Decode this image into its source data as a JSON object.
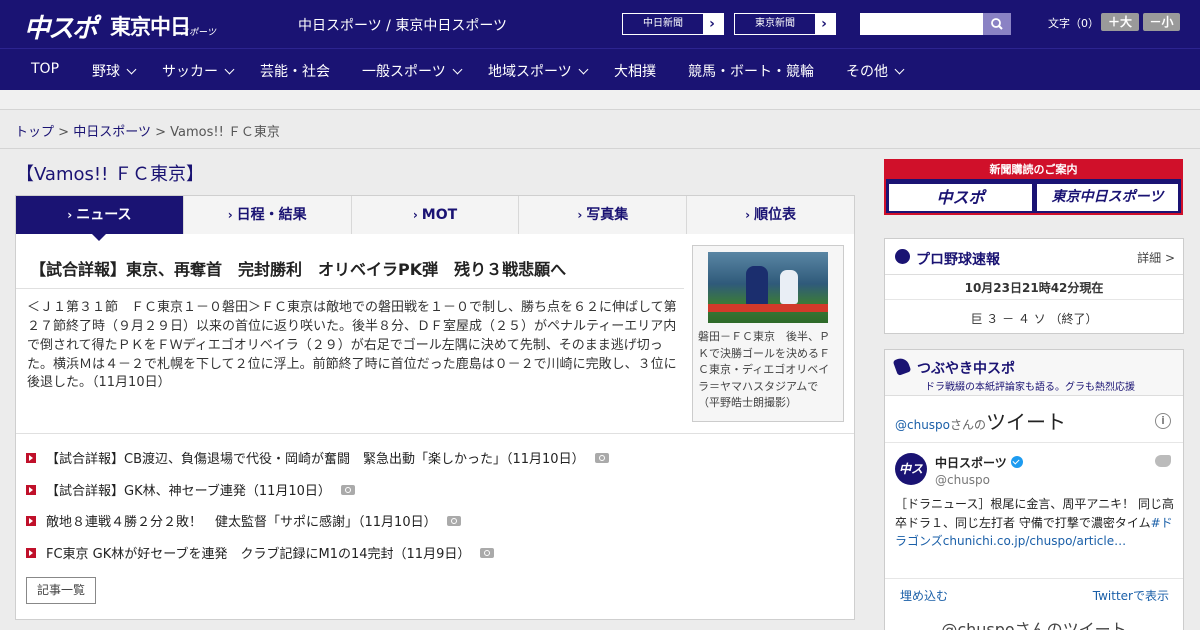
{
  "header": {
    "logo_chuspo": "中スポ",
    "logo_tokyo": "東京中日",
    "logo_tokyo_sub": "スポーツ",
    "site_title": "中日スポーツ / 東京中日スポーツ",
    "paper_buttons": [
      "中日新聞",
      "東京新聞"
    ],
    "search_placeholder": "",
    "text_size_label": "文字（0）",
    "size_up": "＋大",
    "size_down": "－小"
  },
  "nav": {
    "items": [
      {
        "label": "TOP",
        "has_menu": false
      },
      {
        "label": "野球",
        "has_menu": true
      },
      {
        "label": "サッカー",
        "has_menu": true
      },
      {
        "label": "芸能・社会",
        "has_menu": false
      },
      {
        "label": "一般スポーツ",
        "has_menu": true
      },
      {
        "label": "地域スポーツ",
        "has_menu": true
      },
      {
        "label": "大相撲",
        "has_menu": false
      },
      {
        "label": "競馬・ボート・競輪",
        "has_menu": false
      },
      {
        "label": "その他",
        "has_menu": true
      }
    ]
  },
  "breadcrumb": {
    "home": "トップ",
    "section": "中日スポーツ",
    "current": "Vamos!! ＦＣ東京",
    "sep": ">"
  },
  "section_title": "【Vamos!! ＦＣ東京】",
  "tabs": [
    "ニュース",
    "日程・結果",
    "MOT",
    "写真集",
    "順位表"
  ],
  "article": {
    "headline": "【試合詳報】東京、再奪首　完封勝利　オリベイラPK弾　残り３戦悲願へ",
    "body": "＜Ｊ１第３１節　ＦＣ東京１－０磐田＞ＦＣ東京は敵地での磐田戦を１－０で制し、勝ち点を６２に伸ばして第２７節終了時（９月２９日）以来の首位に返り咲いた。後半８分、ＤＦ室屋成（２５）がペナルティーエリア内で倒されて得たＰＫをＦＷディエゴオリベイラ（２９）が右足でゴール左隅に決めて先制、そのまま逃げ切った。横浜Ｍは４－２で札幌を下して２位に浮上。前節終了時に首位だった鹿島は０－２で川崎に完敗し、３位に後退した。（11月10日）",
    "photo_caption": "磐田－ＦＣ東京　後半、ＰＫで決勝ゴールを決めるＦＣ東京・ディエゴオリベイラ＝ヤマハスタジアムで（平野皓士朗撮影）"
  },
  "related": [
    "【試合詳報】CB渡辺、負傷退場で代役・岡崎が奮闘　緊急出動「楽しかった」（11月10日）",
    "【試合詳報】GK林、神セーブ連発（11月10日）",
    "敵地８連戦４勝２分２敗！　健太監督「サポに感謝」（11月10日）",
    "FC東京 GK林が好セーブを連発　クラブ記録にM1の14完封（11月9日）"
  ],
  "list_button": "記事一覧",
  "sidebar": {
    "subscribe_banner": "新聞購読のご案内",
    "subscribe_logos": [
      "中スポ",
      "東京中日スポーツ"
    ],
    "pro": {
      "title": "プロ野球速報",
      "detail": "詳細 >",
      "time": "10月23日21時42分現在",
      "score": "巨 ３ － ４ ソ （終了）"
    },
    "tweets": {
      "title": "つぶやき中スポ",
      "subtitle": "ドラ戦綴の本紙評論家も語る。グラも熱烈応援",
      "handle": "@chuspo",
      "handle_suffix": "さんの",
      "tweet_word": "ツイート",
      "account_name": "中日スポーツ",
      "account_at": "@chuspo",
      "text": "［ドラニュース］根尾に金言、周平アニキ！ 同じ高卒ドラ１、同じ左打者 守備で打撃で濃密タイム",
      "text_link": "#ドラゴンズchunichi.co.jp/chuspo/article…",
      "embed": "埋め込む",
      "view_on": "Twitterで表示",
      "bottom": "@chuspoさんのツイート"
    }
  },
  "colors": {
    "brand_navy": "#1a1373",
    "accent_red": "#d0102a",
    "link_blue": "#1a5fa8"
  }
}
